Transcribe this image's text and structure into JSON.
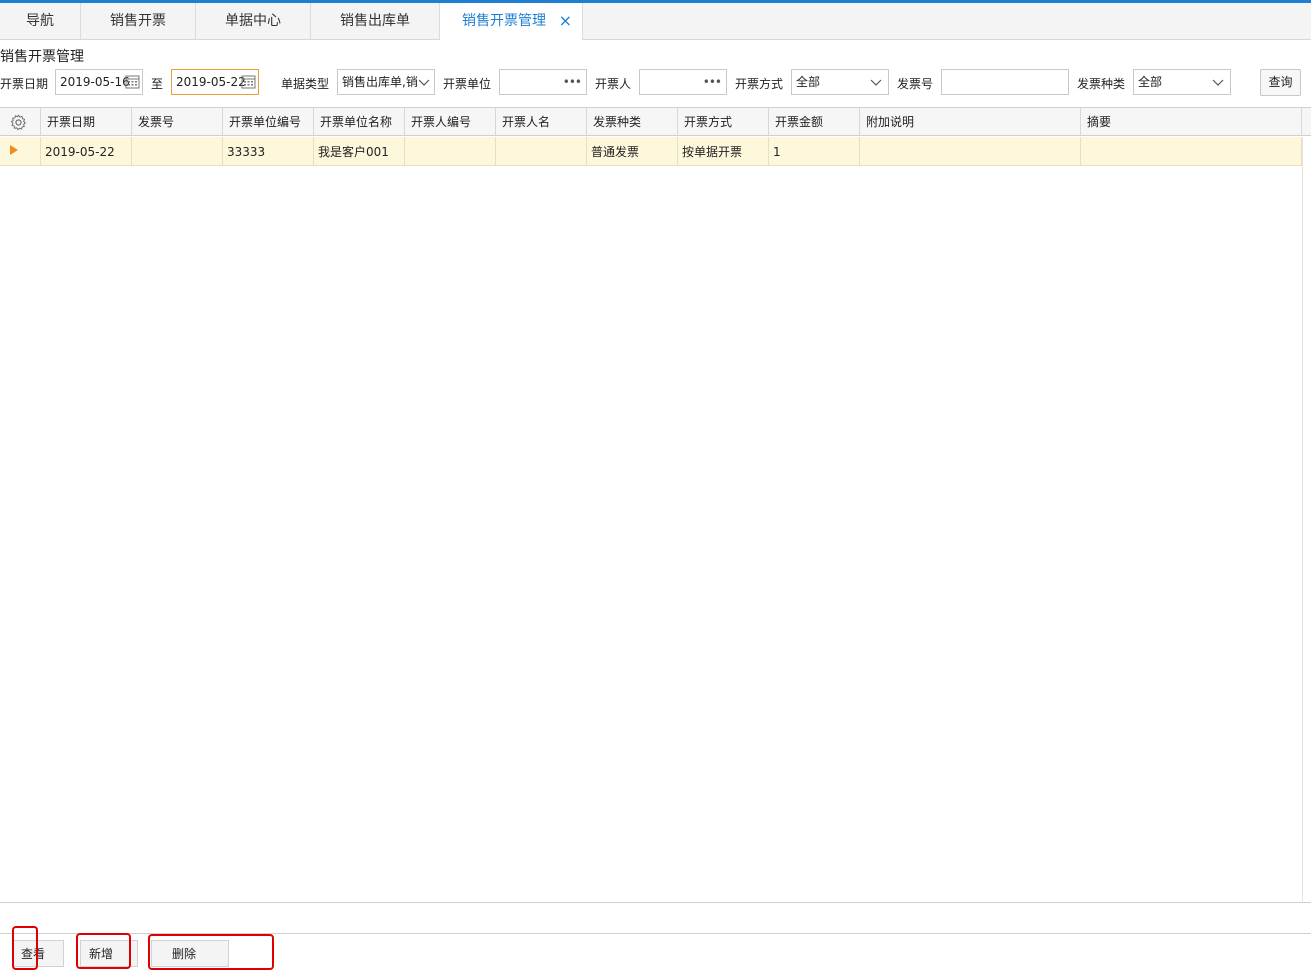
{
  "tabs": [
    {
      "label": "导航"
    },
    {
      "label": "销售开票"
    },
    {
      "label": "单据中心"
    },
    {
      "label": "销售出库单"
    },
    {
      "label": "销售开票管理",
      "close": "×"
    }
  ],
  "page_title": "销售开票管理",
  "filters": {
    "date_label": "开票日期",
    "date_from": "2019-05-16",
    "to_label": "至",
    "date_to": "2019-05-22",
    "doc_type_label": "单据类型",
    "doc_type_value": "销售出库单,销",
    "invoice_unit_label": "开票单位",
    "invoice_unit_value": "",
    "invoicer_label": "开票人",
    "invoicer_value": "",
    "invoice_method_label": "开票方式",
    "invoice_method_value": "全部",
    "invoice_no_label": "发票号",
    "invoice_no_value": "",
    "invoice_kind_label": "发票种类",
    "invoice_kind_value": "全部",
    "query_label": "查询"
  },
  "grid": {
    "columns": [
      "开票日期",
      "发票号",
      "开票单位编号",
      "开票单位名称",
      "开票人编号",
      "开票人名",
      "发票种类",
      "开票方式",
      "开票金额",
      "附加说明",
      "摘要"
    ],
    "rows": [
      [
        "2019-05-22",
        "",
        "33333",
        "我是客户001",
        "",
        "",
        "普通发票",
        "按单据开票",
        "1",
        "",
        ""
      ]
    ]
  },
  "actions": {
    "view_label": "查看",
    "add_label": "新增",
    "delete_label": "删除"
  },
  "colors": {
    "accent": "#1e7fd2",
    "row_highlight": "#fdf8dc",
    "annotation_red": "#e00000",
    "row_marker": "#f08c1a"
  }
}
